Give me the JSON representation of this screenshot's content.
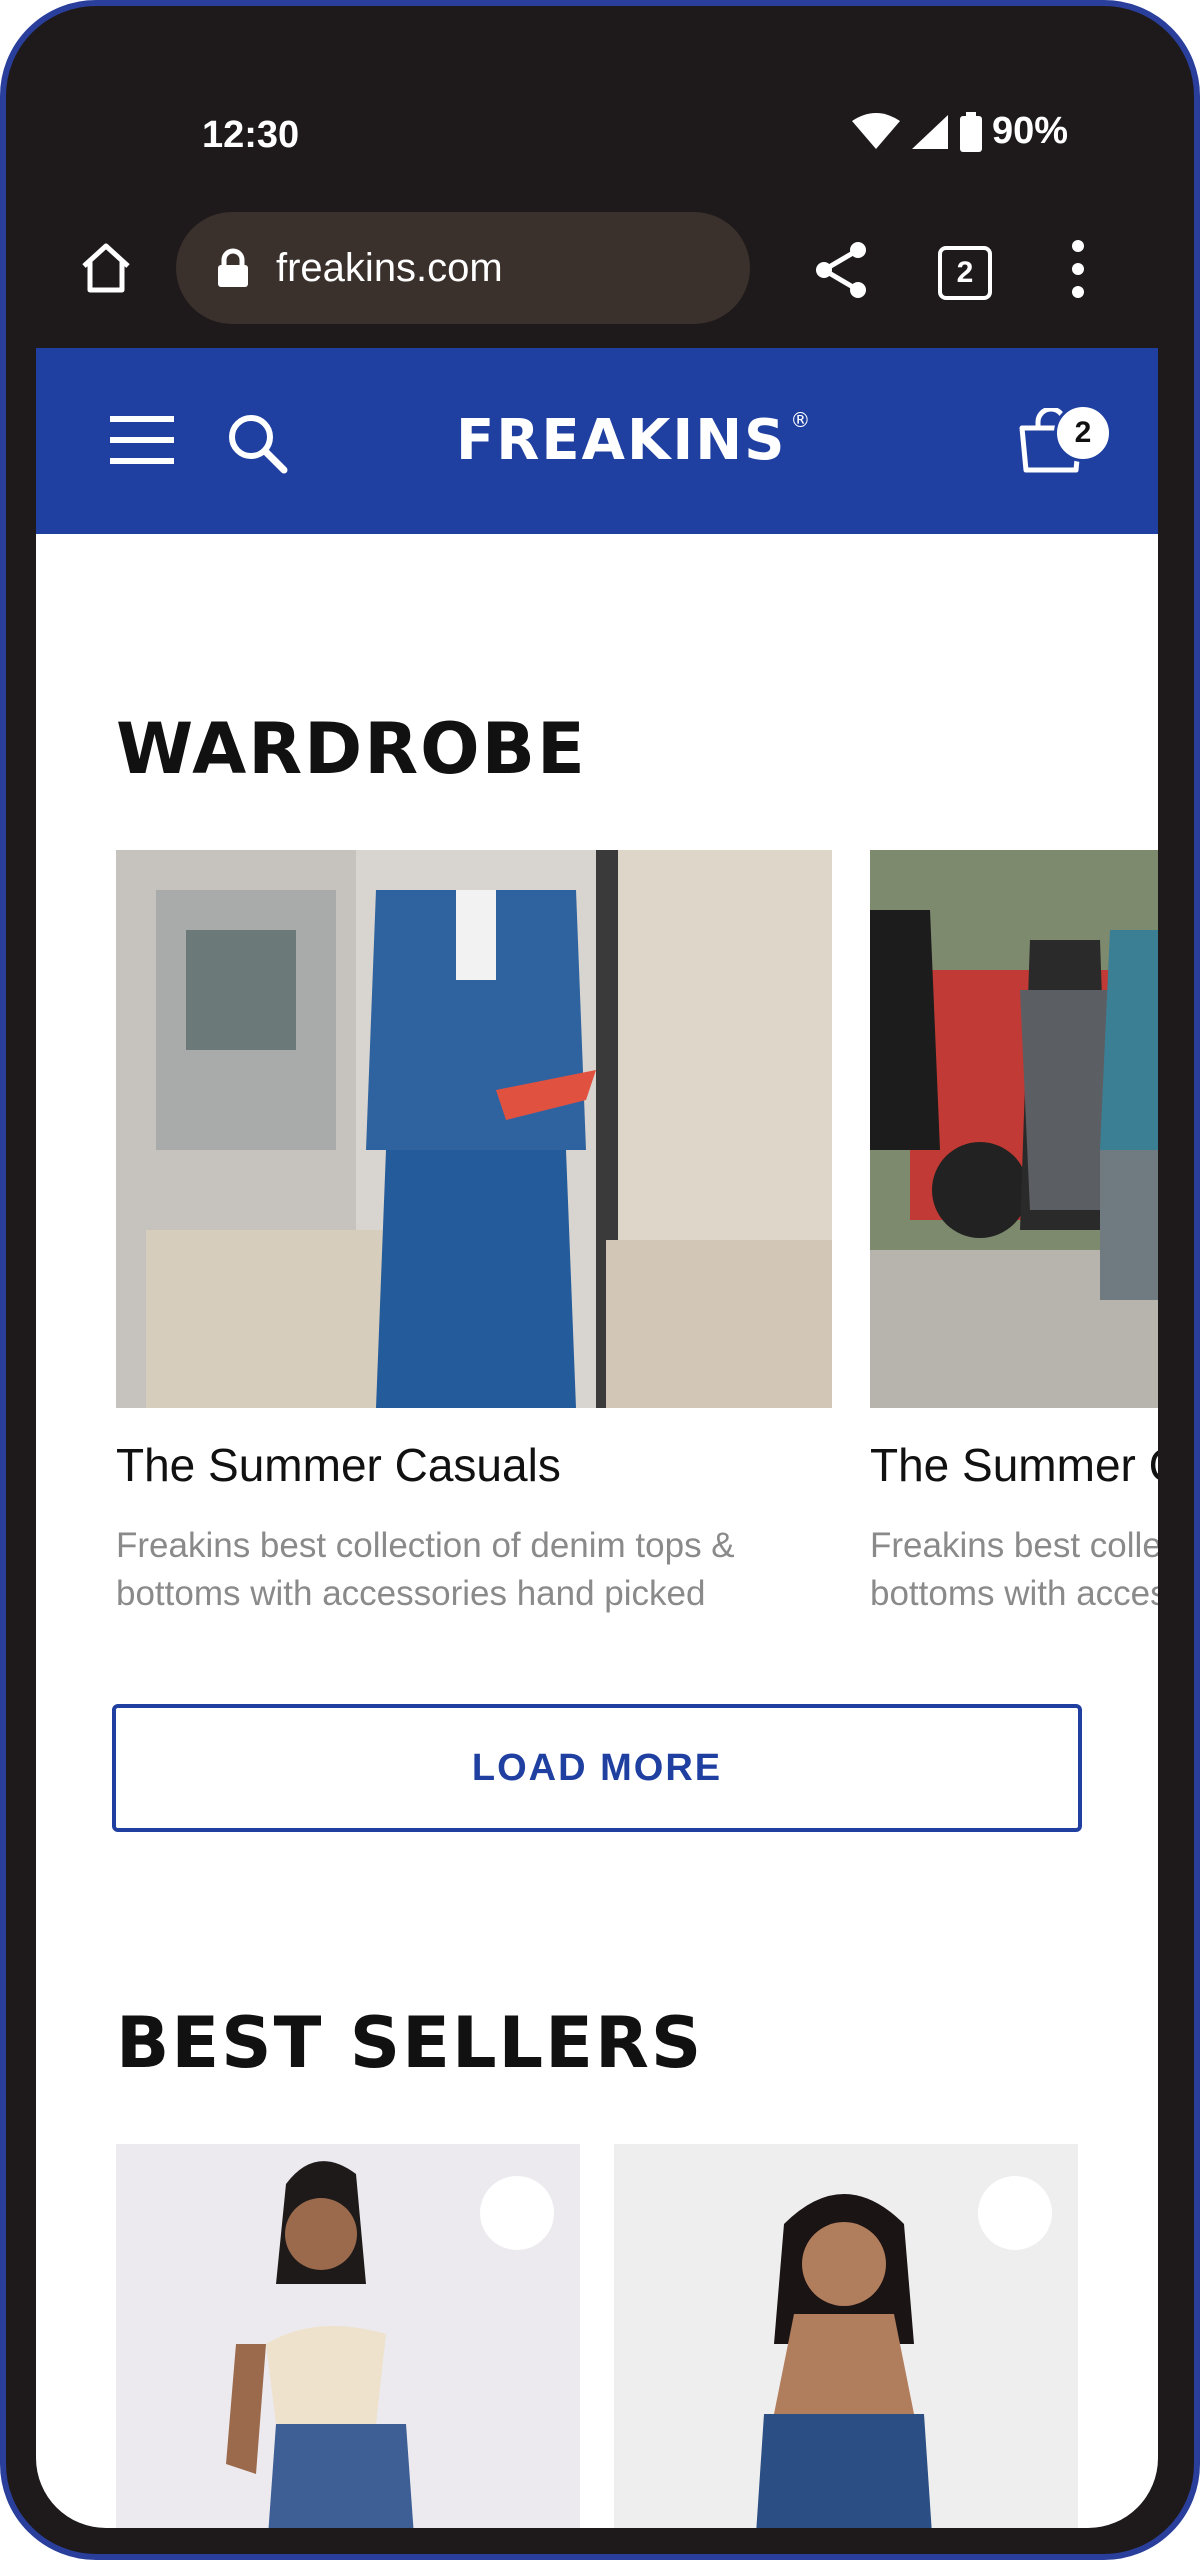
{
  "status_bar": {
    "time": "12:30",
    "battery": "90%"
  },
  "browser": {
    "url": "freakins.com",
    "tab_count": "2"
  },
  "header": {
    "logo_text": "FREAKINS",
    "logo_mark": "®",
    "cart_count": "2",
    "accent_color": "#1f40a0"
  },
  "wardrobe": {
    "title": "WARDROBE",
    "cards": [
      {
        "title": "The Summer Casuals",
        "desc_line1": "Freakins best collection of denim tops &",
        "desc_line2": "bottoms with accessories hand picked"
      },
      {
        "title": "The Summer Casuals",
        "desc_line1": "Freakins best collection of denim tops &",
        "desc_line2": "bottoms with accessories hand picked"
      }
    ],
    "load_more_label": "LOAD MORE"
  },
  "best_sellers": {
    "title": "BEST SELLERS"
  }
}
